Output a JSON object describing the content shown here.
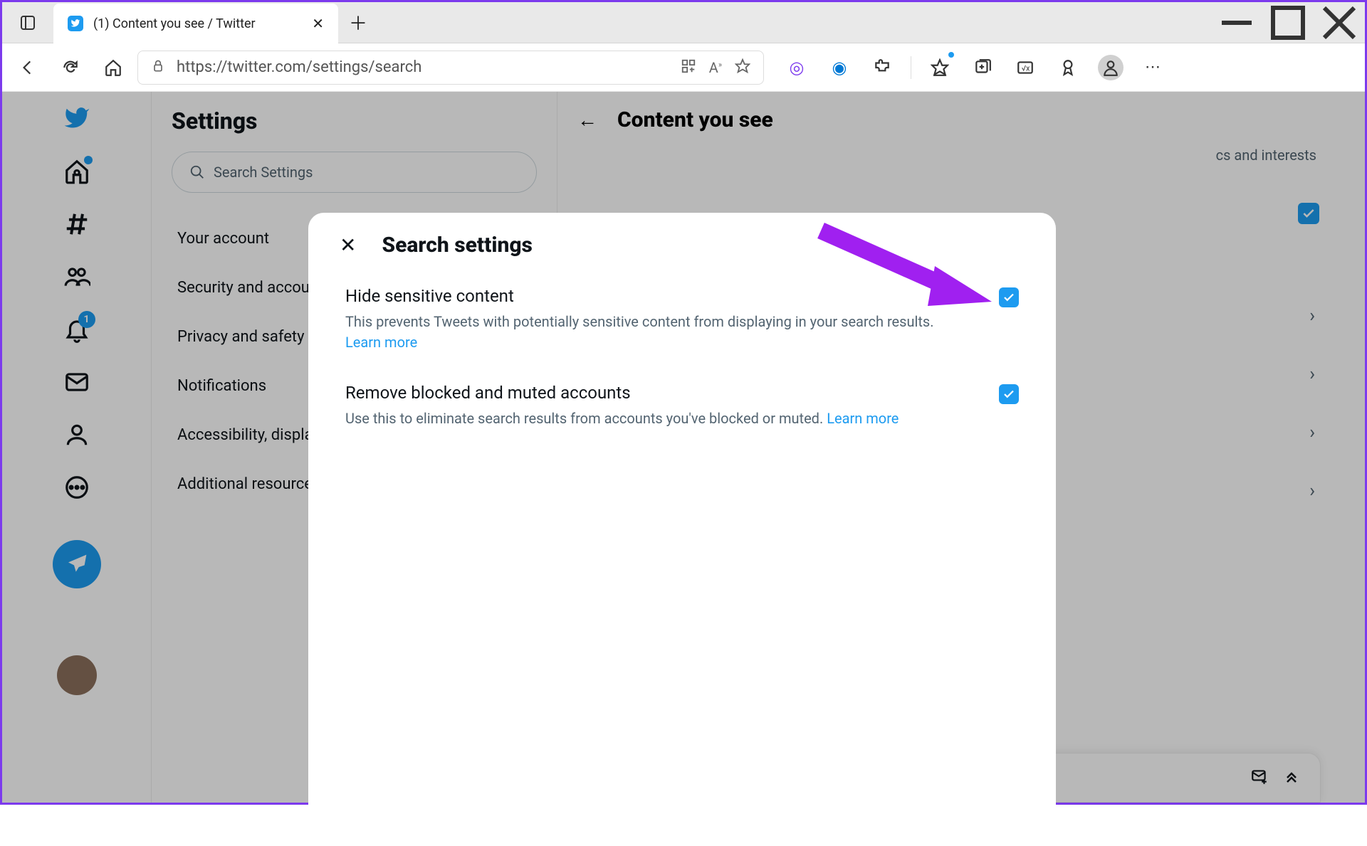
{
  "browser": {
    "tab_title": "(1) Content you see / Twitter",
    "url": "https://twitter.com/settings/search"
  },
  "nav": {
    "notification_badge": "1"
  },
  "settings": {
    "heading": "Settings",
    "search_placeholder": "Search Settings",
    "items": [
      "Your account",
      "Security and account access",
      "Privacy and safety",
      "Notifications",
      "Accessibility, display, and languages",
      "Additional resources"
    ]
  },
  "content": {
    "heading": "Content you see",
    "subtext_fragment": "cs and interests"
  },
  "messages": {
    "label": "Messages"
  },
  "modal": {
    "title": "Search settings",
    "option1": {
      "label": "Hide sensitive content",
      "desc": "This prevents Tweets with potentially sensitive content from displaying in your search results.",
      "learn": "Learn more"
    },
    "option2": {
      "label": "Remove blocked and muted accounts",
      "desc": "Use this to eliminate search results from accounts you've blocked or muted.",
      "learn": "Learn more"
    }
  }
}
